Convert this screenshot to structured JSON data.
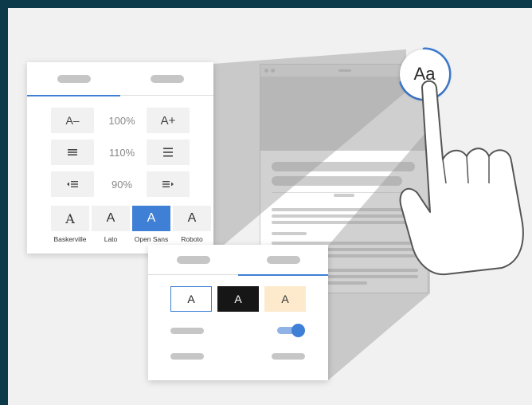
{
  "size_panel": {
    "decrease_label": "A–",
    "increase_label": "A+",
    "font_size": "100%",
    "line_height": "110%",
    "margin": "90%"
  },
  "font_panel": {
    "fonts": [
      {
        "glyph": "A",
        "label": "Baskerville"
      },
      {
        "glyph": "A",
        "label": "Lato"
      },
      {
        "glyph": "A",
        "label": "Open Sans",
        "selected": true
      },
      {
        "glyph": "A",
        "label": "Roboto"
      }
    ]
  },
  "theme_panel": {
    "themes": [
      {
        "glyph": "A",
        "name": "white"
      },
      {
        "glyph": "A",
        "name": "black"
      },
      {
        "glyph": "A",
        "name": "sepia"
      }
    ]
  },
  "badge": {
    "label": "Aa"
  },
  "colors": {
    "accent": "#3f7fd6",
    "frame": "#0d3a4a",
    "sepia": "#fdeacc",
    "dark_theme": "#161616"
  },
  "icons": [
    "align-justify-icon",
    "align-center-icon",
    "indent-decrease-icon",
    "indent-increase-icon",
    "toggle-icon",
    "pointing-hand-icon"
  ]
}
